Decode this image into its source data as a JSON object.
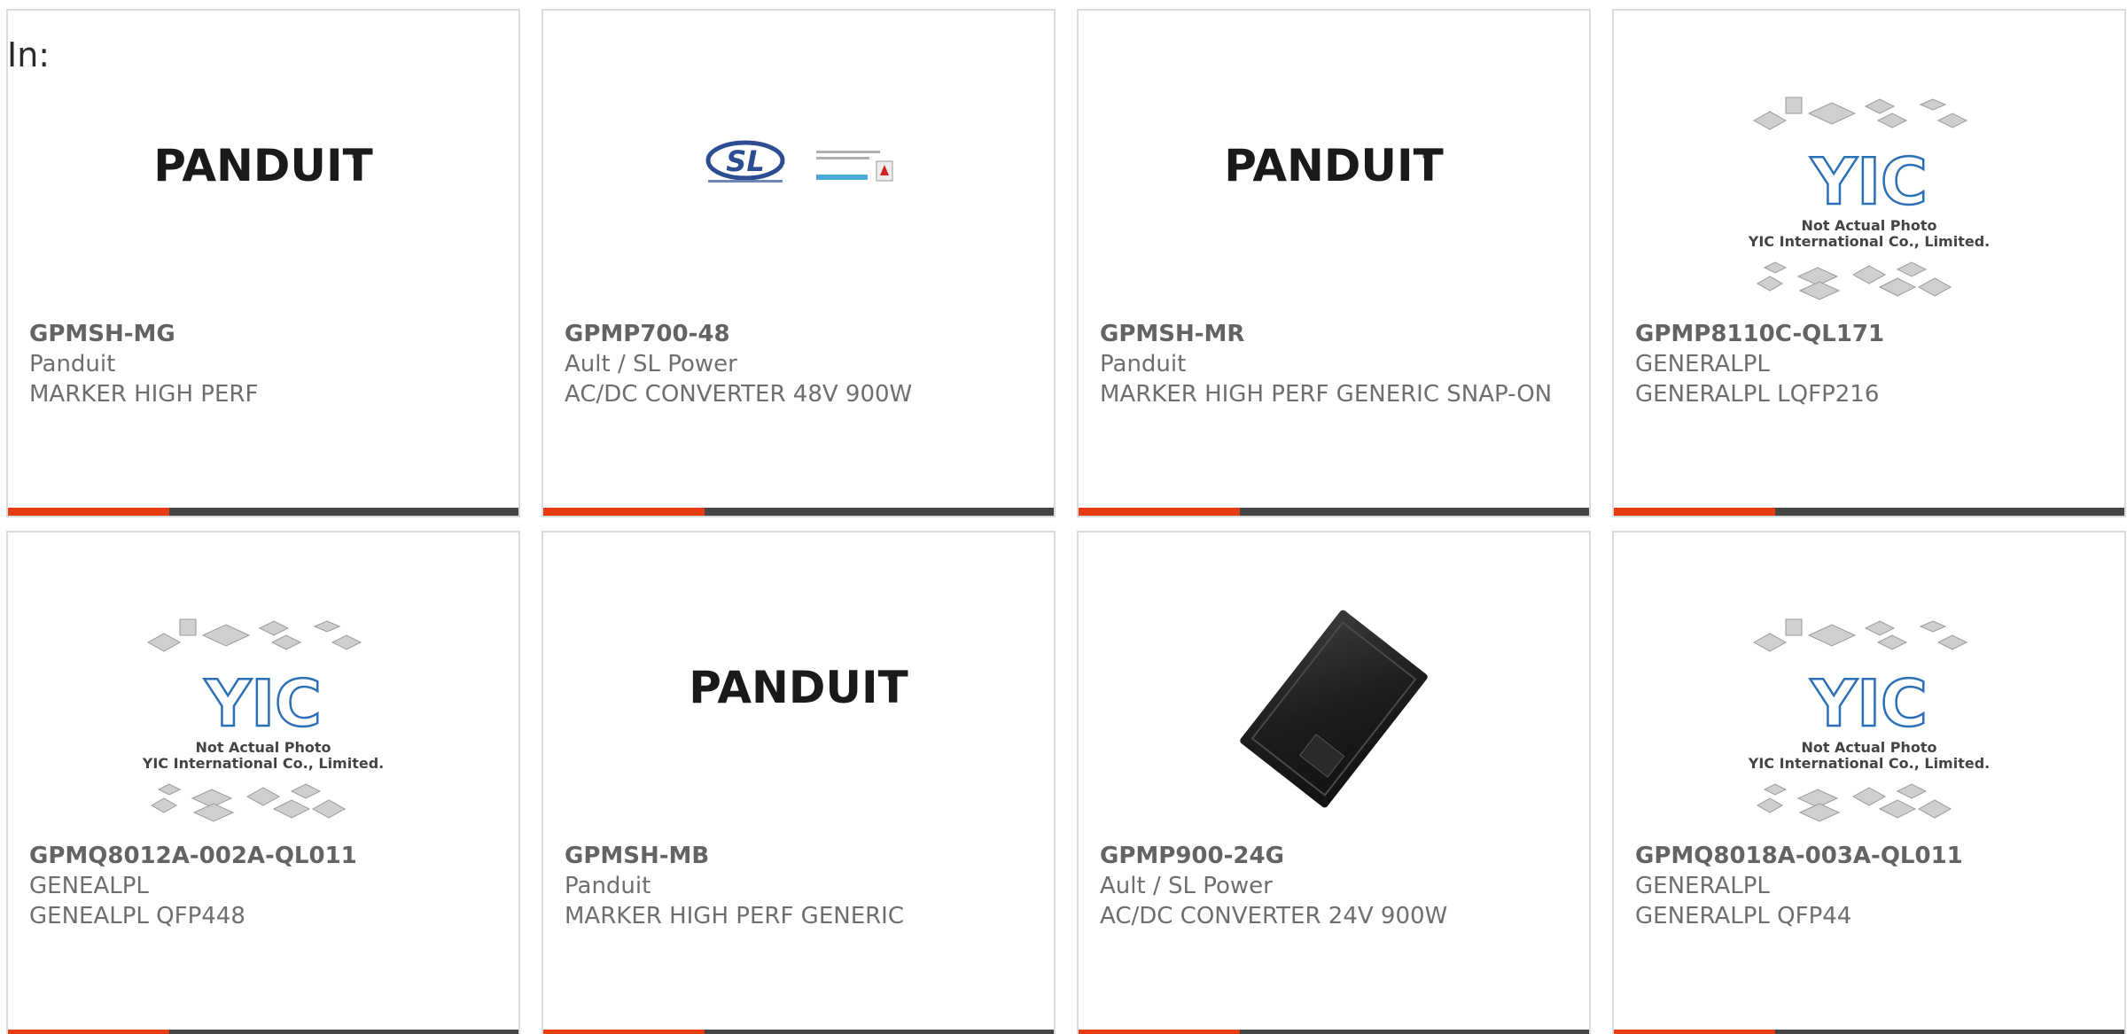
{
  "filter": {
    "in_label": "In:"
  },
  "products": [
    {
      "part_number": "GPMSH-MG",
      "manufacturer": "Panduit",
      "description": "MARKER HIGH PERF",
      "image": "panduit-logo",
      "logo_text": "PANDUIT"
    },
    {
      "part_number": "GPMP700-48",
      "manufacturer": "Ault / SL Power",
      "description": "AC/DC CONVERTER 48V 900W",
      "image": "sl-power-logo",
      "logo_text": "SL"
    },
    {
      "part_number": "GPMSH-MR",
      "manufacturer": "Panduit",
      "description": "MARKER HIGH PERF GENERIC SNAP-ON",
      "image": "panduit-logo",
      "logo_text": "PANDUIT"
    },
    {
      "part_number": "GPMP8110C-QL171",
      "manufacturer": "GENERALPL",
      "description": "GENERALPL LQFP216",
      "image": "yic-placeholder",
      "logo_text": "YIC",
      "placeholder_line1": "Not Actual Photo",
      "placeholder_line2": "YIC International Co., Limited."
    },
    {
      "part_number": "GPMQ8012A-002A-QL011",
      "manufacturer": "GENEALPL",
      "description": "GENEALPL QFP448",
      "image": "yic-placeholder",
      "logo_text": "YIC",
      "placeholder_line1": "Not Actual Photo",
      "placeholder_line2": "YIC International Co., Limited."
    },
    {
      "part_number": "GPMSH-MB",
      "manufacturer": "Panduit",
      "description": "MARKER HIGH PERF GENERIC",
      "image": "panduit-logo",
      "logo_text": "PANDUIT"
    },
    {
      "part_number": "GPMP900-24G",
      "manufacturer": "Ault / SL Power",
      "description": "AC/DC CONVERTER 24V 900W",
      "image": "power-supply-photo"
    },
    {
      "part_number": "GPMQ8018A-003A-QL011",
      "manufacturer": "GENERALPL",
      "description": "GENERALPL QFP44",
      "image": "yic-placeholder",
      "logo_text": "YIC",
      "placeholder_line1": "Not Actual Photo",
      "placeholder_line2": "YIC International Co., Limited."
    }
  ],
  "colors": {
    "accent": "#e63c12",
    "bar": "#454545",
    "border": "#dcdcdc",
    "text": "#6e6e6e",
    "yic_blue": "#2b6fb6"
  }
}
